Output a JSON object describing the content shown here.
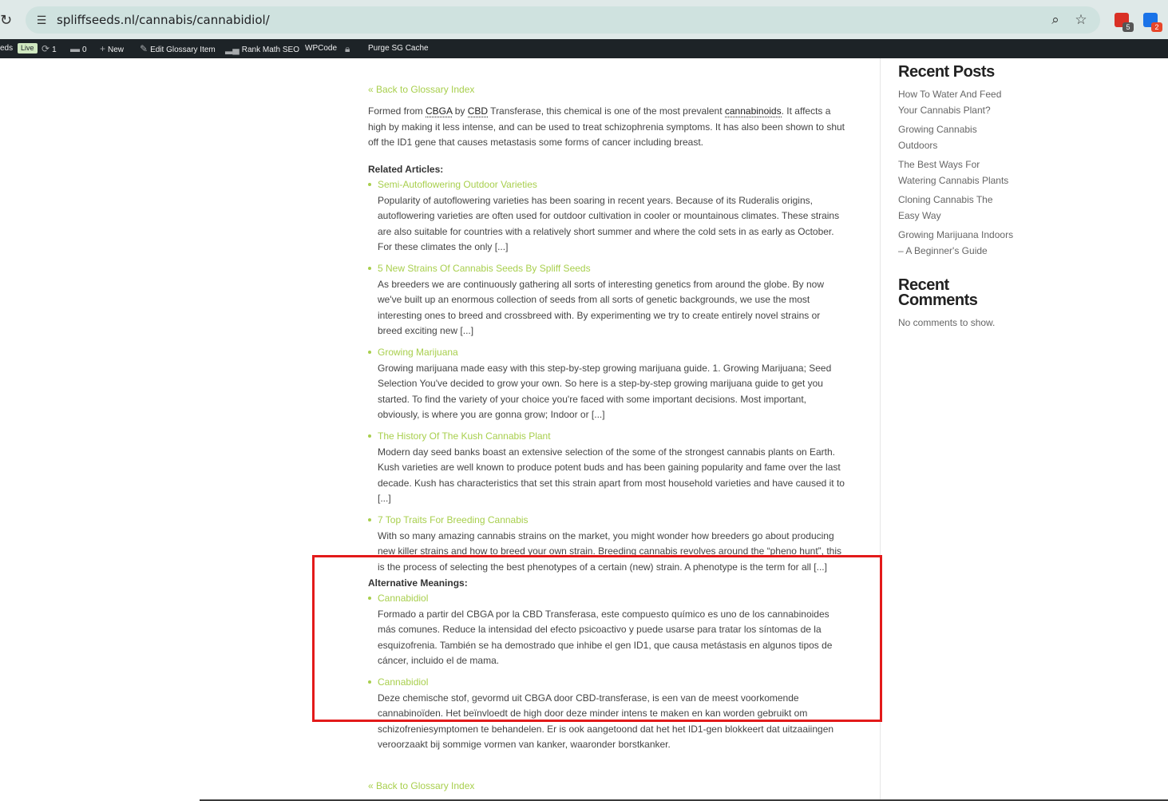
{
  "browser": {
    "url": "spliffseeds.nl/cannabis/cannabidiol/",
    "extensions": [
      {
        "name": "extension-red",
        "badge": "5",
        "color": "#d93025",
        "badge_color": "#555555"
      },
      {
        "name": "extension-blue",
        "badge": "2",
        "color": "#1a73e8",
        "badge_color": "#e8462a"
      }
    ]
  },
  "adminbar": {
    "site": "eds",
    "live": "Live",
    "updates": "1",
    "comments": "0",
    "new": "New",
    "edit": "Edit Glossary Item",
    "seo": "Rank Math SEO",
    "wpcode": "WPCode",
    "purge": "Purge SG Cache"
  },
  "content": {
    "back_link": "« Back to Glossary Index",
    "intro": {
      "p1": "Formed from ",
      "t1": "CBGA",
      "p2": " by ",
      "t2": "CBD",
      "p3": " Transferase, this chemical is one of the most prevalent ",
      "t3": "cannabinoids",
      "p4": ". It affects a high by making it less intense, and can be used to treat schizophrenia symptoms. It has also been shown to shut off the ID1 gene that causes metastasis some forms of cancer including breast."
    },
    "related_title": "Related Articles:",
    "related": [
      {
        "title": "Semi-Autoflowering Outdoor Varieties",
        "text": "Popularity of autoflowering varieties has been soaring in recent years. Because of its Ruderalis origins, autoflowering varieties are often used for outdoor cultivation in cooler or mountainous climates. These strains are also suitable for countries with a relatively short summer and where the cold sets in as early as October. For these climates the only [...]"
      },
      {
        "title": "5 New Strains Of Cannabis Seeds By Spliff Seeds",
        "text": "As breeders we are continuously gathering all sorts of interesting genetics from around the globe. By now we've built up an enormous collection of seeds from all sorts of genetic backgrounds, we use the most interesting ones to breed and crossbreed with. By experimenting we try to create entirely novel strains or breed exciting new [...]"
      },
      {
        "title": "Growing Marijuana",
        "text": "Growing marijuana made easy with this step-by-step growing marijuana guide. 1. Growing Marijuana; Seed Selection You've decided to grow your own. So here is a step-by-step growing marijuana guide to get you started. To find the variety of your choice you're faced with some important decisions. Most important, obviously, is where you are gonna grow; Indoor or [...]"
      },
      {
        "title": "The History Of The Kush Cannabis Plant",
        "text": "Modern day seed banks boast an extensive selection of the some of the strongest cannabis plants on Earth. Kush varieties are well known to produce potent buds and has been gaining popularity and fame over the last decade. Kush has characteristics that set this strain apart from most household varieties and have caused it to [...]"
      },
      {
        "title": "7 Top Traits For Breeding Cannabis",
        "text": "With so many amazing cannabis strains on the market, you might wonder how breeders go about producing new killer strains and how to breed your own strain. Breeding cannabis revolves around the “pheno hunt”, this is the process of selecting the best phenotypes of a certain (new) strain. A phenotype is the term for all [...]"
      }
    ],
    "alt_title": "Alternative Meanings:",
    "alternatives": [
      {
        "title": "Cannabidiol",
        "text": "Formado a partir del CBGA por la CBD Transferasa, este compuesto químico es uno de los cannabinoides más comunes. Reduce la intensidad del efecto psicoactivo y puede usarse para tratar los síntomas de la esquizofrenia. También se ha demostrado que inhibe el gen ID1, que causa metástasis en algunos tipos de cáncer, incluido el de mama."
      },
      {
        "title": "Cannabidiol",
        "text": "Deze chemische stof, gevormd uit CBGA door CBD-transferase, is een van de meest voorkomende cannabinoïden. Het beïnvloedt de high door deze minder intens te maken en kan worden gebruikt om schizofreniesymptomen te behandelen. Er is ook aangetoond dat het het ID1-gen blokkeert dat uitzaaiingen veroorzaakt bij sommige vormen van kanker, waaronder borstkanker."
      }
    ]
  },
  "sidebar": {
    "recent_posts_title": "Recent Posts",
    "posts": [
      "How To Water And Feed Your Cannabis Plant?",
      "Growing Cannabis Outdoors",
      "The Best Ways For Watering Cannabis Plants",
      "Cloning Cannabis The Easy Way",
      "Growing Marijuana Indoors – A Beginner's Guide"
    ],
    "recent_comments_title": "Recent Comments",
    "no_comments": "No comments to show."
  },
  "colors": {
    "link_green": "#a8cf4d",
    "highlight_red": "#e31a1a",
    "adminbar_bg": "#1d2327"
  }
}
